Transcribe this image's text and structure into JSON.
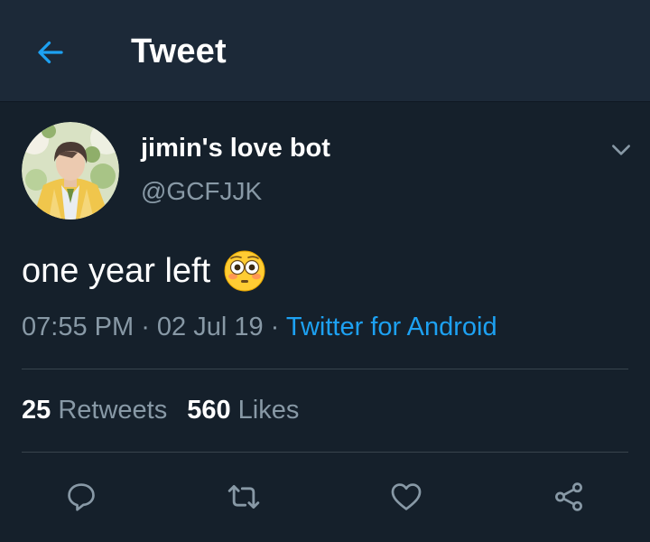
{
  "header": {
    "title": "Tweet"
  },
  "tweet": {
    "display_name": "jimin's love bot",
    "handle": "@GCFJJK",
    "text": "one year left",
    "emoji": "flushed-face",
    "time": "07:55 PM",
    "separator_1": " · ",
    "date": "02 Jul 19",
    "separator_2": " · ",
    "source": "Twitter for Android"
  },
  "stats": {
    "retweets_count": "25",
    "retweets_label": "Retweets",
    "likes_count": "560",
    "likes_label": "Likes"
  },
  "icons": {
    "back": "arrow-left-icon",
    "caret": "chevron-down-icon",
    "reply": "reply-icon",
    "retweet": "retweet-icon",
    "like": "heart-icon",
    "share": "share-icon"
  },
  "colors": {
    "background": "#15202b",
    "header_background": "#1c2938",
    "accent": "#1da1f2",
    "secondary_text": "#8899a6",
    "divider": "#38444d"
  }
}
